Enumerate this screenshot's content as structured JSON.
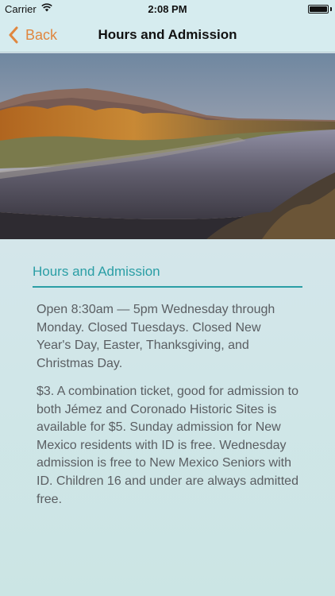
{
  "status_bar": {
    "carrier": "Carrier",
    "time": "2:08 PM",
    "wifi_icon": "wifi-icon",
    "battery_icon": "battery-icon",
    "battery_level": 1.0
  },
  "nav": {
    "back_label": "Back",
    "back_icon": "chevron-left-icon",
    "title": "Hours and Admission",
    "accent_color": "#e0873f"
  },
  "hero": {
    "image": "river-landscape-photo"
  },
  "section": {
    "title": "Hours and Admission",
    "title_color": "#2a9ea5",
    "paragraphs": [
      "Open 8:30am — 5pm Wednesday through Monday. Closed Tuesdays. Closed New Year's Day, Easter, Thanksgiving, and Christmas Day.",
      "$3. A combination ticket, good for admission to both Jémez and Coronado Historic Sites is available for $5. Sunday admission for New Mexico residents with ID is free. Wednesday admission is free to New Mexico Seniors with ID. Children 16 and under are always admitted free."
    ]
  }
}
